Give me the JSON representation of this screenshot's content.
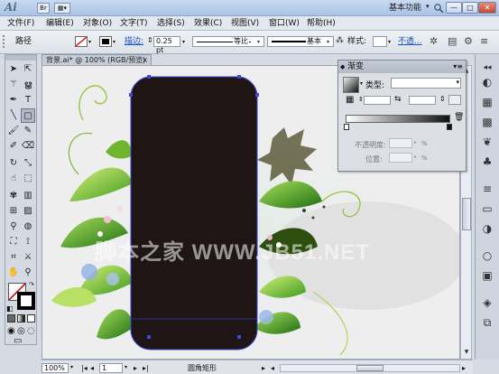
{
  "titlebar": {
    "logo": "Ai",
    "workspace": "基本功能",
    "window_buttons": [
      "—",
      "□",
      "✕"
    ]
  },
  "menubar": {
    "items": [
      "文件(F)",
      "编辑(E)",
      "对象(O)",
      "文字(T)",
      "选择(S)",
      "效果(C)",
      "视图(V)",
      "窗口(W)",
      "帮助(H)"
    ]
  },
  "controlbar": {
    "object_type": "路径",
    "stroke_link": "描边:",
    "stroke_weight": "0.25 pt",
    "profile_label": "等比",
    "brush_label": "基本",
    "style_label": "样式:",
    "opacity_link": "不透..."
  },
  "document": {
    "tab_title": "背景.ai* @ 100% (RGB/预览)",
    "tab_close": "×",
    "watermark": "脚本之家 WWW.JB51.NET"
  },
  "gradient_panel": {
    "title": "渐变",
    "type_label": "类型:",
    "opacity_label": "不透明度:",
    "location_label": "位置:",
    "percent": "%"
  },
  "statusbar": {
    "zoom": "100%",
    "page": "1",
    "tool_name": "圆角矩形"
  },
  "colors": {
    "accent": "#1a4fbf",
    "rounded_rect_fill": "#1f1515",
    "selection": "#3d49d8"
  },
  "tools": [
    "selection-tool",
    "direct-selection-tool",
    "magic-wand-tool",
    "lasso-tool",
    "pen-tool",
    "type-tool",
    "line-tool",
    "rounded-rectangle-tool",
    "paintbrush-tool",
    "pencil-tool",
    "blob-brush-tool",
    "eraser-tool",
    "rotate-tool",
    "scale-tool",
    "warp-tool",
    "free-transform-tool",
    "symbol-sprayer-tool",
    "column-graph-tool",
    "mesh-tool",
    "gradient-tool",
    "eyedropper-tool",
    "blend-tool",
    "live-paint-tool",
    "live-paint-selection-tool",
    "artboard-tool",
    "slice-tool",
    "hand-tool",
    "zoom-tool"
  ]
}
